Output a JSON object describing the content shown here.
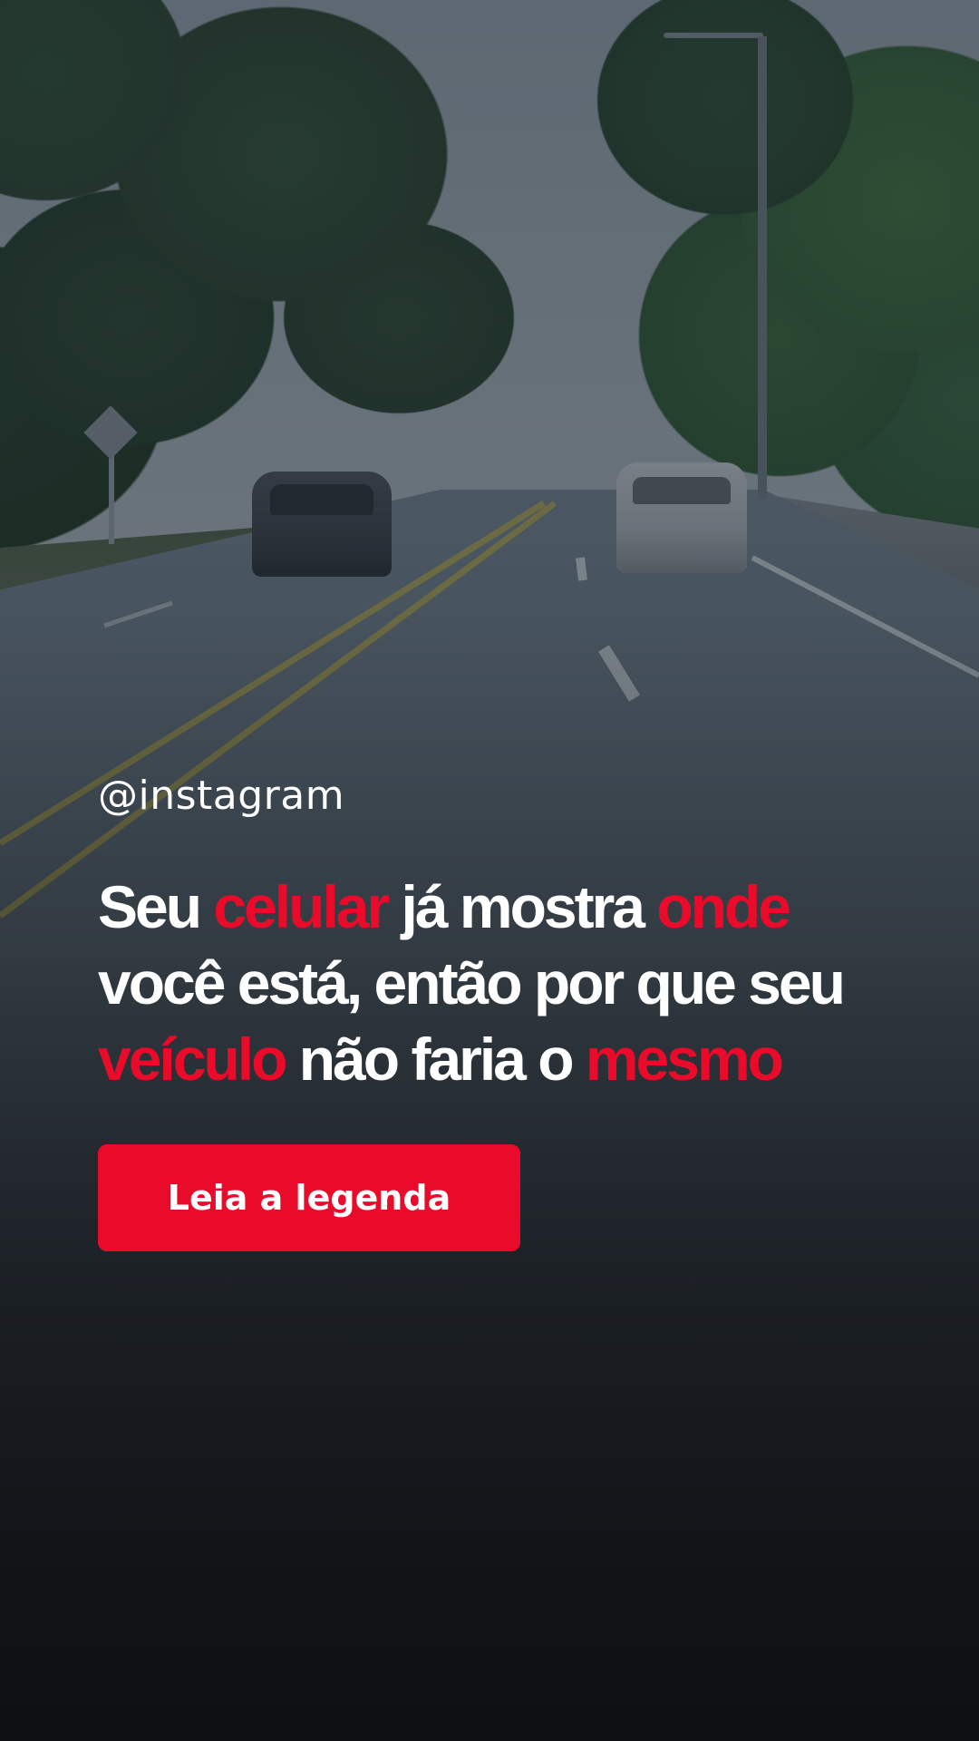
{
  "background": {
    "photo_description": "road-with-cars-and-trees",
    "overlay_color": "#0f1114"
  },
  "colors": {
    "accent": "#ea0a2a",
    "text": "#ffffff"
  },
  "post": {
    "handle": "@instagram",
    "headline_parts": [
      {
        "text": "Seu ",
        "highlight": false
      },
      {
        "text": "celular",
        "highlight": true
      },
      {
        "text": " já mostra ",
        "highlight": false
      },
      {
        "text": "onde",
        "highlight": true
      },
      {
        "text": " você está, então por que seu ",
        "highlight": false
      },
      {
        "text": "veículo",
        "highlight": true
      },
      {
        "text": " não faria o ",
        "highlight": false
      },
      {
        "text": "mesmo",
        "highlight": true
      }
    ],
    "cta_label": "Leia a legenda"
  }
}
